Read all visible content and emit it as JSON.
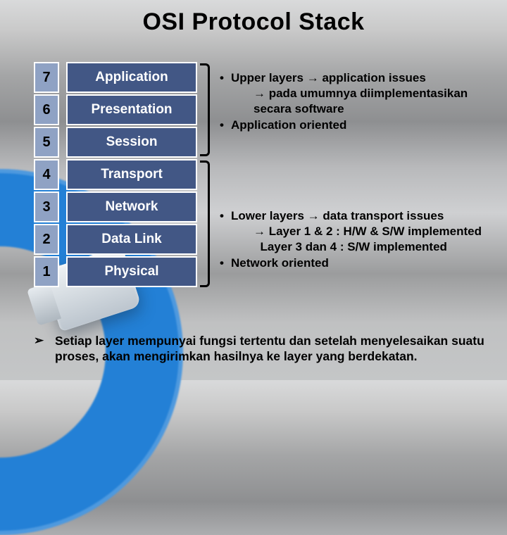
{
  "title": "OSI Protocol Stack",
  "layers": [
    {
      "num": "7",
      "name": "Application"
    },
    {
      "num": "6",
      "name": "Presentation"
    },
    {
      "num": "5",
      "name": "Session"
    },
    {
      "num": "4",
      "name": "Transport"
    },
    {
      "num": "3",
      "name": "Network"
    },
    {
      "num": "2",
      "name": "Data Link"
    },
    {
      "num": "1",
      "name": "Physical"
    }
  ],
  "upper": {
    "b1": "Upper layers → application issues",
    "s1": "→ pada umumnya diimplementasikan",
    "s2": "secara software",
    "b2": "Application oriented"
  },
  "lower": {
    "b1": "Lower layers → data transport issues",
    "s1": "→ Layer 1 & 2 : H/W & S/W implemented",
    "s2": "  Layer 3 dan 4 : S/W implemented",
    "b2": "Network oriented"
  },
  "footer": {
    "mark": "➢",
    "text": "Setiap layer mempunyai fungsi tertentu dan setelah menyelesaikan suatu proses, akan mengirimkan hasilnya ke layer yang berdekatan."
  }
}
